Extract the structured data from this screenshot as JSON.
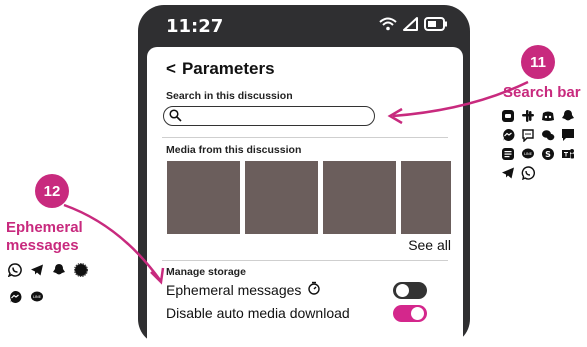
{
  "status_bar": {
    "time": "11:27"
  },
  "screen": {
    "back_label": "<",
    "title": "Parameters",
    "search_label": "Search in this discussion",
    "search_placeholder": "",
    "media_label": "Media from this discussion",
    "see_all": "See all",
    "storage_label": "Manage storage",
    "ephemeral_label": "Ephemeral messages",
    "auto_download_label": "Disable auto media download",
    "ephemeral_on": false,
    "auto_download_on": true
  },
  "callouts": [
    {
      "number": "11",
      "label": "Search bar"
    },
    {
      "number": "12",
      "label_line1": "Ephemeral",
      "label_line2": "messages"
    }
  ],
  "colors": {
    "accent": "#c82a7e",
    "toggle_on": "#d4278c",
    "thumb": "#6b5e5c",
    "phone": "#2f2f31"
  },
  "icons": {
    "search_bar_apps": [
      "signal-icon",
      "slack-icon",
      "discord-icon",
      "snapchat-icon",
      "messenger-icon",
      "chat-bubble-icon",
      "wechat-icon",
      "message-square-icon",
      "google-messages-icon",
      "line-icon",
      "skype-icon",
      "teams-icon",
      "telegram-icon",
      "viber-icon"
    ],
    "ephemeral_apps": [
      "whatsapp-icon",
      "telegram-icon",
      "snapchat-icon",
      "signal-icon",
      "messenger-icon",
      "line-icon"
    ]
  }
}
